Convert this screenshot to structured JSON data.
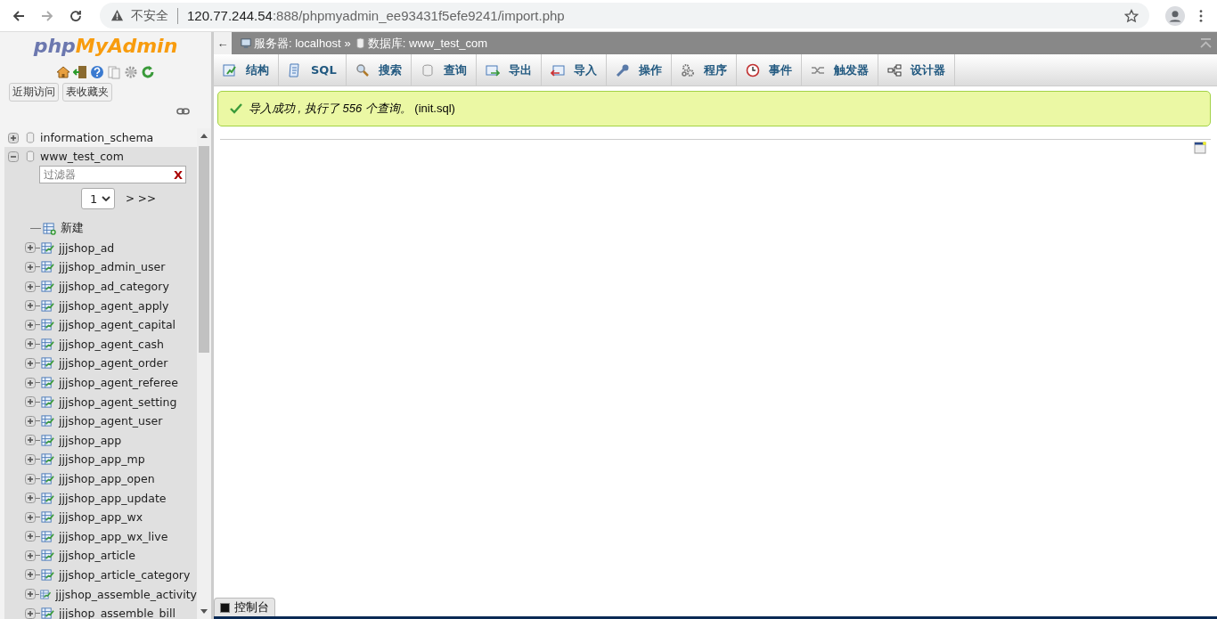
{
  "browser": {
    "security": "不安全",
    "url_host": "120.77.244.54",
    "url_rest": ":888/phpmyadmin_ee93431f5efe9241/import.php"
  },
  "sidebar": {
    "logo": [
      "php",
      "MyAdmin"
    ],
    "buttons": [
      "近期访问",
      "表收藏夹"
    ],
    "databases": [
      {
        "name": "information_schema",
        "expanded": false
      },
      {
        "name": "www_test_com",
        "expanded": true,
        "filter_placeholder": "过滤器",
        "filter_clear": "X",
        "page": "1",
        "page_next": "> >>",
        "new_label": "新建",
        "tables": [
          {
            "name": "jjjshop_ad",
            "expanded": false
          },
          {
            "name": "jjjshop_admin_user",
            "expanded": false
          },
          {
            "name": "jjjshop_ad_category",
            "expanded": false
          },
          {
            "name": "jjjshop_agent_apply",
            "expanded": false
          },
          {
            "name": "jjjshop_agent_capital",
            "expanded": false
          },
          {
            "name": "jjjshop_agent_cash",
            "expanded": false
          },
          {
            "name": "jjjshop_agent_order",
            "expanded": false
          },
          {
            "name": "jjjshop_agent_referee",
            "expanded": false
          },
          {
            "name": "jjjshop_agent_setting",
            "expanded": false
          },
          {
            "name": "jjjshop_agent_user",
            "expanded": false
          },
          {
            "name": "jjjshop_app",
            "expanded": false
          },
          {
            "name": "jjjshop_app_mp",
            "expanded": false
          },
          {
            "name": "jjjshop_app_open",
            "expanded": false
          },
          {
            "name": "jjjshop_app_update",
            "expanded": false
          },
          {
            "name": "jjjshop_app_wx",
            "expanded": false
          },
          {
            "name": "jjjshop_app_wx_live",
            "expanded": false
          },
          {
            "name": "jjjshop_article",
            "expanded": false
          },
          {
            "name": "jjjshop_article_category",
            "expanded": false
          },
          {
            "name": "jjjshop_assemble_activity",
            "expanded": false
          },
          {
            "name": "jjjshop_assemble_bill",
            "expanded": false
          }
        ]
      }
    ]
  },
  "breadcrumb": {
    "back": "←",
    "server": "服务器: localhost",
    "separator": "»",
    "database": "数据库: www_test_com"
  },
  "tabs": [
    {
      "label": "结构",
      "kind": "structure"
    },
    {
      "label": "SQL",
      "kind": "sql"
    },
    {
      "label": "搜索",
      "kind": "search"
    },
    {
      "label": "查询",
      "kind": "query"
    },
    {
      "label": "导出",
      "kind": "export"
    },
    {
      "label": "导入",
      "kind": "import"
    },
    {
      "label": "操作",
      "kind": "operations"
    },
    {
      "label": "程序",
      "kind": "routines"
    },
    {
      "label": "事件",
      "kind": "events"
    },
    {
      "label": "触发器",
      "kind": "triggers"
    },
    {
      "label": "设计器",
      "kind": "designer"
    }
  ],
  "message": {
    "kind": "success",
    "text": "*导入成功 , 执行了 556 个查询。* (init.sql)"
  },
  "console": {
    "label": "控制台"
  }
}
